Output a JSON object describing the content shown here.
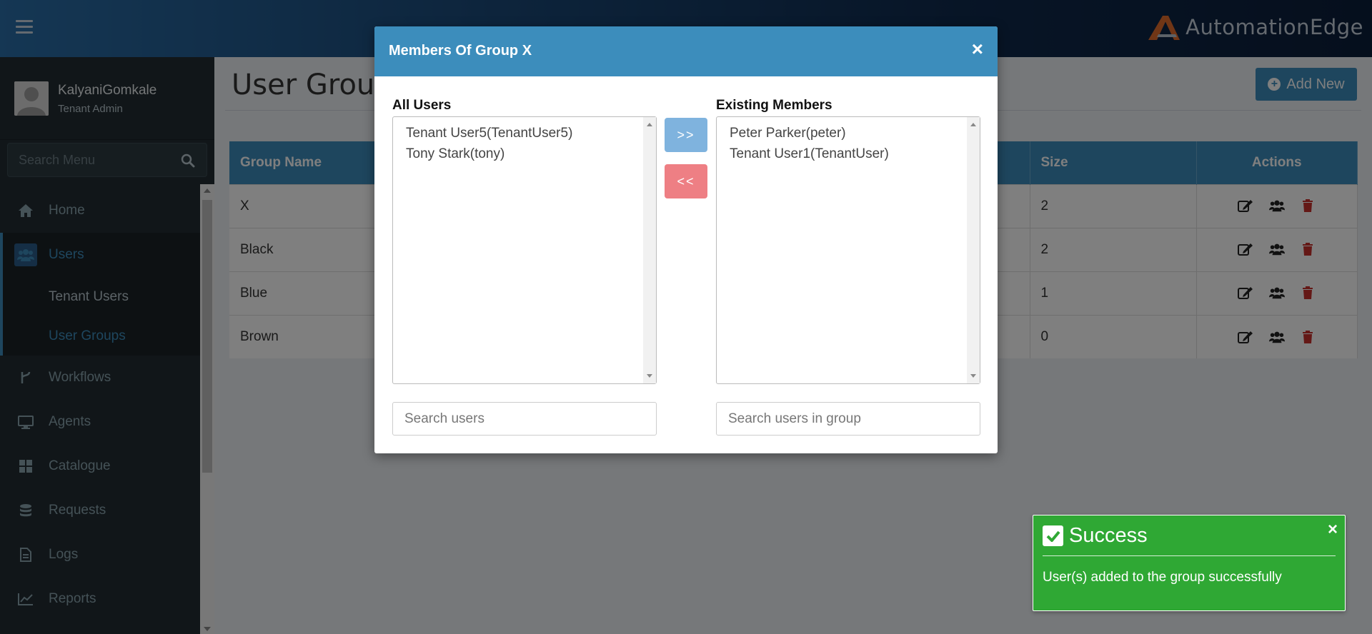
{
  "header": {
    "logo_text": "AutomationEdge",
    "logo_color": "#e06c2c"
  },
  "user": {
    "name": "KalyaniGomkale",
    "role": "Tenant Admin"
  },
  "sidebar": {
    "search_placeholder": "Search Menu",
    "items": [
      {
        "label": "Home",
        "icon": "home-icon"
      },
      {
        "label": "Users",
        "icon": "users-icon",
        "active": true
      },
      {
        "label": "Workflows",
        "icon": "workflow-icon"
      },
      {
        "label": "Agents",
        "icon": "monitor-icon"
      },
      {
        "label": "Catalogue",
        "icon": "grid-icon"
      },
      {
        "label": "Requests",
        "icon": "database-icon"
      },
      {
        "label": "Logs",
        "icon": "file-icon"
      },
      {
        "label": "Reports",
        "icon": "chart-icon"
      }
    ],
    "submenu": [
      {
        "label": "Tenant Users"
      },
      {
        "label": "User Groups",
        "active": true
      }
    ]
  },
  "page": {
    "title": "User Groups",
    "add_new_label": "Add New"
  },
  "table": {
    "headers": {
      "group_name": "Group Name",
      "size": "Size",
      "actions": "Actions"
    },
    "rows": [
      {
        "name": "X",
        "size": "2"
      },
      {
        "name": "Black",
        "size": "2"
      },
      {
        "name": "Blue",
        "size": "1"
      },
      {
        "name": "Brown",
        "size": "0"
      }
    ]
  },
  "modal": {
    "title": "Members Of Group X",
    "close_label": "×",
    "all_users_label": "All Users",
    "existing_members_label": "Existing Members",
    "all_users": [
      "Tenant User5(TenantUser5)",
      "Tony Stark(tony)"
    ],
    "existing_members": [
      "Peter Parker(peter)",
      "Tenant User1(TenantUser)"
    ],
    "move_right_label": ">>",
    "move_left_label": "<<",
    "search_users_placeholder": "Search users",
    "search_group_placeholder": "Search users in group"
  },
  "toast": {
    "title": "Success",
    "close_label": "×",
    "message": "User(s) added to the group successfully",
    "color": "#2fa834"
  },
  "colors": {
    "primary": "#3c8dbc",
    "danger": "#ee7f84",
    "sidebar": "#222d32"
  }
}
